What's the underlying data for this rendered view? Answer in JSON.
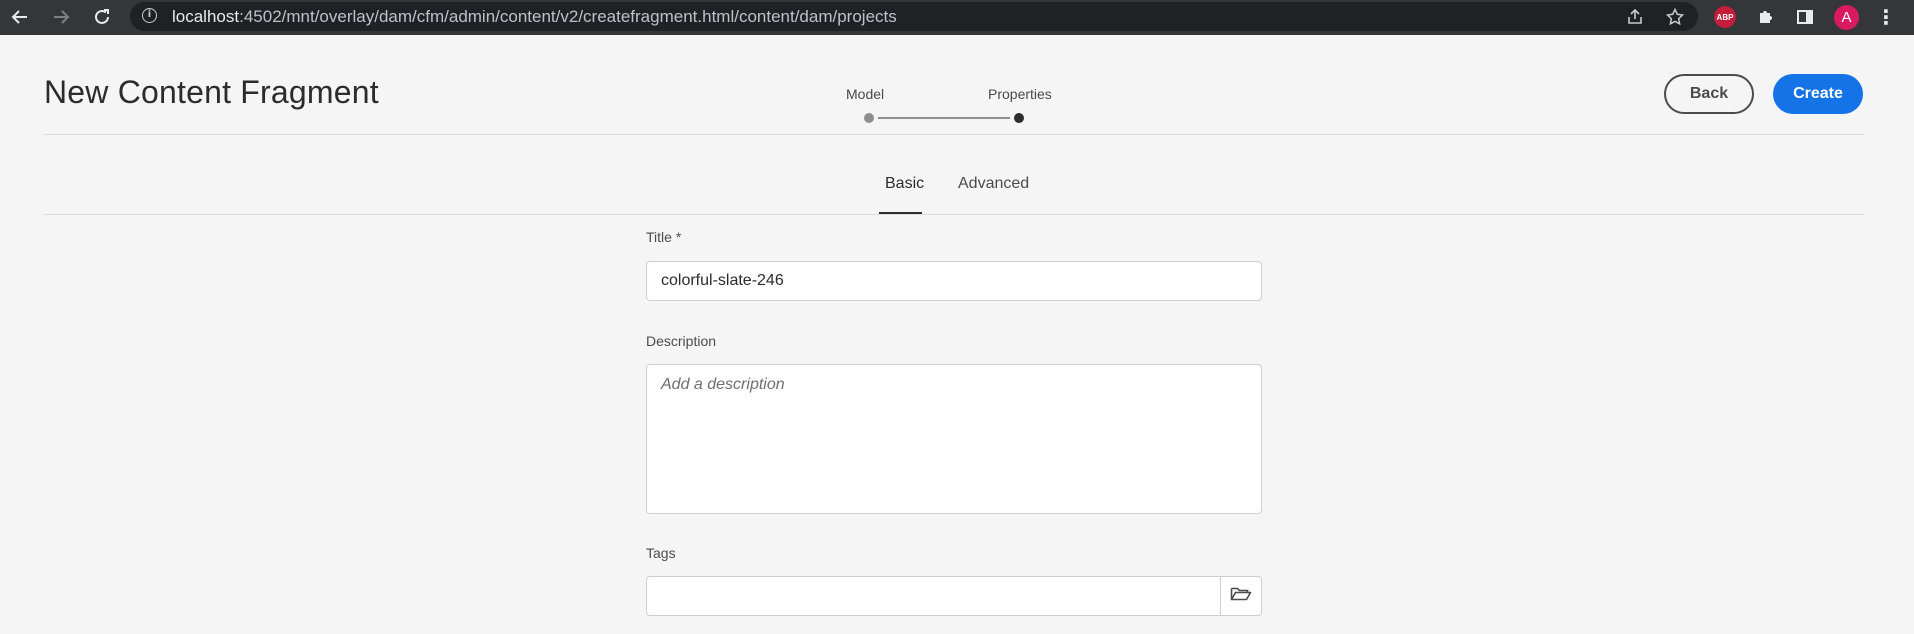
{
  "browser": {
    "url_host": "localhost",
    "url_rest": ":4502/mnt/overlay/dam/cfm/admin/content/v2/createfragment.html/content/dam/projects",
    "abp_label": "ABP",
    "avatar_letter": "A"
  },
  "header": {
    "title": "New Content Fragment",
    "steps": [
      {
        "label": "Model",
        "state": "completed"
      },
      {
        "label": "Properties",
        "state": "current"
      }
    ],
    "back_label": "Back",
    "create_label": "Create"
  },
  "tabs": [
    {
      "label": "Basic",
      "active": true
    },
    {
      "label": "Advanced",
      "active": false
    }
  ],
  "form": {
    "title_label": "Title *",
    "title_value": "colorful-slate-246",
    "description_label": "Description",
    "description_placeholder": "Add a description",
    "tags_label": "Tags",
    "tags_value": ""
  },
  "colors": {
    "accent": "#1473e6",
    "chrome": "#35363a",
    "background": "#f5f5f5"
  }
}
